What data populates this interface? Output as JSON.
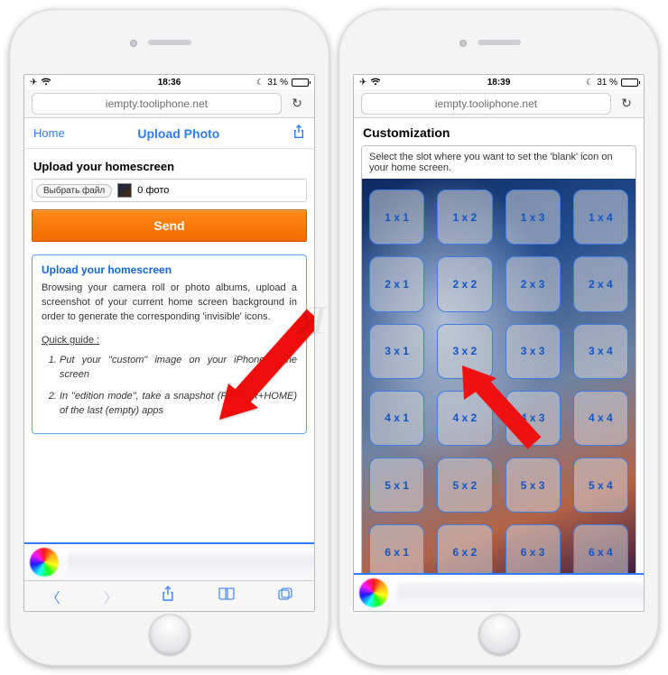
{
  "watermark": "Я",
  "left": {
    "status": {
      "time": "18:36",
      "battery": "31 %"
    },
    "url": "iempty.tooliphone.net",
    "nav": {
      "home": "Home",
      "title": "Upload Photo"
    },
    "sectionTitle": "Upload your homescreen",
    "chooseFile": "Выбрать файл",
    "fileStatus": "0 фото",
    "sendLabel": "Send",
    "card": {
      "title": "Upload your homescreen",
      "body": "Browsing your camera roll or photo albums, upload a screenshot of your current home screen background in order to generate the corresponding 'invisible' icons.",
      "quickGuide": "Quick guide :",
      "step1": "Put your \"custom\" image on your iPhone home screen",
      "step2": "In \"edition mode\", take a snapshot (POWER+HOME) of the last (empty) apps"
    }
  },
  "right": {
    "status": {
      "time": "18:39",
      "battery": "31 %"
    },
    "url": "iempty.tooliphone.net",
    "title": "Customization",
    "instruction": "Select the slot where you want to set the 'blank' icon on your home screen.",
    "slots": [
      [
        "1 x 1",
        "1 x 2",
        "1 x 3",
        "1 x 4"
      ],
      [
        "2 x 1",
        "2 x 2",
        "2 x 3",
        "2 x 4"
      ],
      [
        "3 x 1",
        "3 x 2",
        "3 x 3",
        "3 x 4"
      ],
      [
        "4 x 1",
        "4 x 2",
        "4 x 3",
        "4 x 4"
      ],
      [
        "5 x 1",
        "5 x 2",
        "5 x 3",
        "5 x 4"
      ],
      [
        "6 x 1",
        "6 x 2",
        "6 x 3",
        "6 x 4"
      ]
    ]
  }
}
